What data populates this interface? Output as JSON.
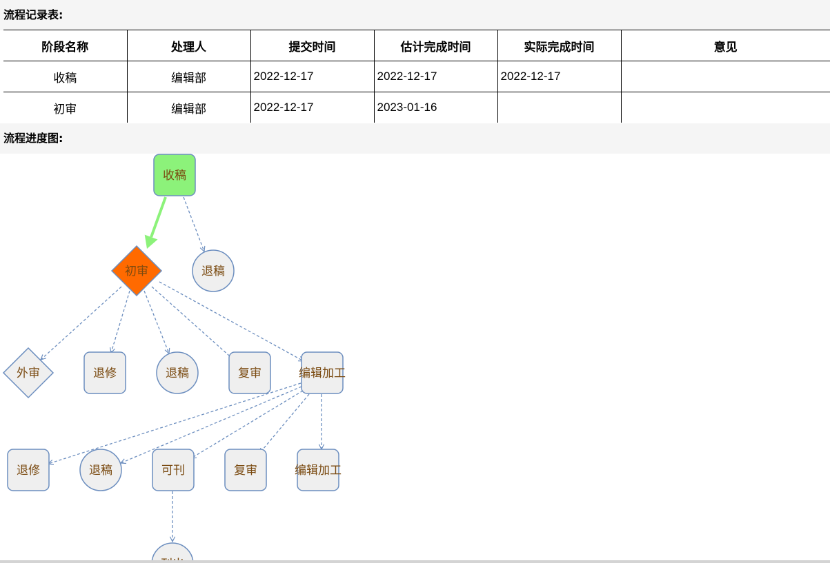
{
  "record_section": {
    "title": "流程记录表:"
  },
  "table": {
    "headers": [
      "阶段名称",
      "处理人",
      "提交时间",
      "估计完成时间",
      "实际完成时间",
      "意见"
    ],
    "rows": [
      [
        "收稿",
        "编辑部",
        "2022-12-17",
        "2022-12-17",
        "2022-12-17",
        ""
      ],
      [
        "初审",
        "编辑部",
        "2022-12-17",
        "2023-01-16",
        "",
        ""
      ]
    ]
  },
  "diagram_section": {
    "title": "流程进度图:"
  },
  "diagram": {
    "colors": {
      "completed": "#8cf27a",
      "current": "#ff6a00",
      "pending": "#efefef",
      "border": "#6c8ebf",
      "label": "#7a4a10"
    },
    "nodes": [
      {
        "id": "n1",
        "label": "收稿",
        "shape": "rounded-rect",
        "state": "completed"
      },
      {
        "id": "n2",
        "label": "初审",
        "shape": "diamond",
        "state": "current"
      },
      {
        "id": "n3",
        "label": "退稿",
        "shape": "circle",
        "state": "pending"
      },
      {
        "id": "n4",
        "label": "外审",
        "shape": "diamond",
        "state": "pending"
      },
      {
        "id": "n5",
        "label": "退修",
        "shape": "rounded-rect",
        "state": "pending"
      },
      {
        "id": "n6",
        "label": "退稿",
        "shape": "circle",
        "state": "pending"
      },
      {
        "id": "n7",
        "label": "复审",
        "shape": "rounded-rect",
        "state": "pending"
      },
      {
        "id": "n8",
        "label": "编辑加工",
        "shape": "rounded-rect",
        "state": "pending"
      },
      {
        "id": "n9",
        "label": "退修",
        "shape": "rounded-rect",
        "state": "pending"
      },
      {
        "id": "n10",
        "label": "退稿",
        "shape": "circle",
        "state": "pending"
      },
      {
        "id": "n11",
        "label": "可刊",
        "shape": "rounded-rect",
        "state": "pending"
      },
      {
        "id": "n12",
        "label": "复审",
        "shape": "rounded-rect",
        "state": "pending"
      },
      {
        "id": "n13",
        "label": "编辑加工",
        "shape": "rounded-rect",
        "state": "pending"
      },
      {
        "id": "n14",
        "label": "刊出",
        "shape": "circle",
        "state": "pending"
      }
    ],
    "edges": [
      {
        "from": "n1",
        "to": "n2",
        "style": "solid-completed"
      },
      {
        "from": "n1",
        "to": "n3",
        "style": "dashed"
      },
      {
        "from": "n2",
        "to": "n4",
        "style": "dashed"
      },
      {
        "from": "n2",
        "to": "n5",
        "style": "dashed"
      },
      {
        "from": "n2",
        "to": "n6",
        "style": "dashed"
      },
      {
        "from": "n2",
        "to": "n7",
        "style": "dashed"
      },
      {
        "from": "n2",
        "to": "n8",
        "style": "dashed"
      },
      {
        "from": "n8",
        "to": "n9",
        "style": "dashed"
      },
      {
        "from": "n8",
        "to": "n10",
        "style": "dashed"
      },
      {
        "from": "n8",
        "to": "n11",
        "style": "dashed"
      },
      {
        "from": "n8",
        "to": "n12",
        "style": "dashed"
      },
      {
        "from": "n8",
        "to": "n13",
        "style": "dashed"
      },
      {
        "from": "n11",
        "to": "n14",
        "style": "dashed"
      }
    ]
  }
}
